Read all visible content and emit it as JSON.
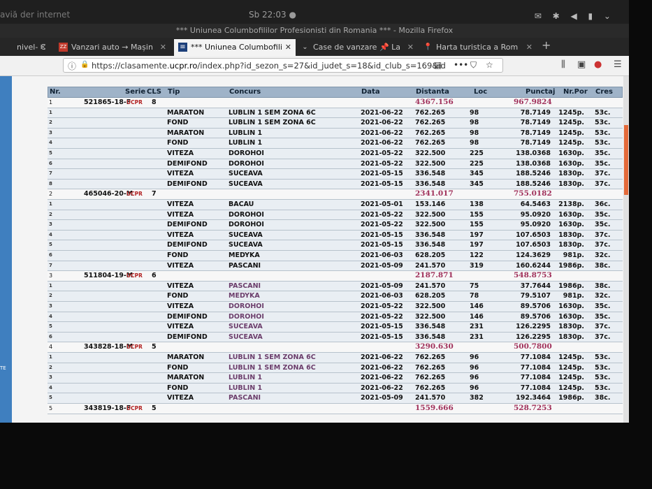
{
  "system": {
    "left_text": "aviă der internet",
    "clock": "Sb 22:03 ●",
    "icons": "✉ ✱ ◀ ▮ ⌄"
  },
  "window": {
    "title": "*** Uniunea Columbofililor Profesionisti din Romania *** - Mozilla Firefox"
  },
  "tabs": [
    {
      "label": "nivel- C",
      "icon": "",
      "active": false
    },
    {
      "label": "Vanzari auto → Mașin",
      "icon": "ZZ",
      "active": false
    },
    {
      "label": "*** Uniunea Columbofili",
      "icon": "≡",
      "active": true
    },
    {
      "label": "Case de vanzare 📌 La",
      "icon": "⌄",
      "active": false
    },
    {
      "label": "Harta turistica a Rom",
      "icon": "📍",
      "active": false
    }
  ],
  "newtab": "+",
  "url": {
    "prefix": "https://clasamente.",
    "domain": "ucpr.ro",
    "rest": "/index.php?id_sezon_s=27&id_judet_s=18&id_club_s=169&id"
  },
  "table": {
    "headers": [
      "Nr.",
      "Serie",
      "CLS",
      "Tip",
      "Concurs",
      "Data",
      "Distanta",
      "Loc",
      "Punctaj",
      "Nr.Por",
      "Cres"
    ],
    "groups": [
      {
        "nr": "1",
        "serie": "521865-18-F",
        "org": "UCPR",
        "cls": "8",
        "dist_total": "4367.156",
        "punctaj_total": "967.9824",
        "rows": [
          [
            "MARATON",
            "LUBLIN 1 SEM ZONA 6C",
            "2021-06-22",
            "762.265",
            "98",
            "78.7149",
            "1245p.",
            "53c."
          ],
          [
            "FOND",
            "LUBLIN 1 SEM ZONA 6C",
            "2021-06-22",
            "762.265",
            "98",
            "78.7149",
            "1245p.",
            "53c."
          ],
          [
            "MARATON",
            "LUBLIN 1",
            "2021-06-22",
            "762.265",
            "98",
            "78.7149",
            "1245p.",
            "53c."
          ],
          [
            "FOND",
            "LUBLIN 1",
            "2021-06-22",
            "762.265",
            "98",
            "78.7149",
            "1245p.",
            "53c."
          ],
          [
            "VITEZA",
            "DOROHOI",
            "2021-05-22",
            "322.500",
            "225",
            "138.0368",
            "1630p.",
            "35c."
          ],
          [
            "DEMIFOND",
            "DOROHOI",
            "2021-05-22",
            "322.500",
            "225",
            "138.0368",
            "1630p.",
            "35c."
          ],
          [
            "VITEZA",
            "SUCEAVA",
            "2021-05-15",
            "336.548",
            "345",
            "188.5246",
            "1830p.",
            "37c."
          ],
          [
            "DEMIFOND",
            "SUCEAVA",
            "2021-05-15",
            "336.548",
            "345",
            "188.5246",
            "1830p.",
            "37c."
          ]
        ]
      },
      {
        "nr": "2",
        "serie": "465046-20-M",
        "org": "UCPR",
        "cls": "7",
        "dist_total": "2341.017",
        "punctaj_total": "755.0182",
        "rows": [
          [
            "VITEZA",
            "BACAU",
            "2021-05-01",
            "153.146",
            "138",
            "64.5463",
            "2138p.",
            "36c."
          ],
          [
            "VITEZA",
            "DOROHOI",
            "2021-05-22",
            "322.500",
            "155",
            "95.0920",
            "1630p.",
            "35c."
          ],
          [
            "DEMIFOND",
            "DOROHOI",
            "2021-05-22",
            "322.500",
            "155",
            "95.0920",
            "1630p.",
            "35c."
          ],
          [
            "VITEZA",
            "SUCEAVA",
            "2021-05-15",
            "336.548",
            "197",
            "107.6503",
            "1830p.",
            "37c."
          ],
          [
            "DEMIFOND",
            "SUCEAVA",
            "2021-05-15",
            "336.548",
            "197",
            "107.6503",
            "1830p.",
            "37c."
          ],
          [
            "FOND",
            "MEDYKA",
            "2021-06-03",
            "628.205",
            "122",
            "124.3629",
            "981p.",
            "32c."
          ],
          [
            "VITEZA",
            "PASCANI",
            "2021-05-09",
            "241.570",
            "319",
            "160.6244",
            "1986p.",
            "38c."
          ]
        ]
      },
      {
        "nr": "3",
        "serie": "511804-19-M",
        "org": "UCPR",
        "cls": "6",
        "dist_total": "2187.871",
        "punctaj_total": "548.8753",
        "rows": [
          [
            "VITEZA",
            "PASCANI",
            "2021-05-09",
            "241.570",
            "75",
            "37.7644",
            "1986p.",
            "38c."
          ],
          [
            "FOND",
            "MEDYKA",
            "2021-06-03",
            "628.205",
            "78",
            "79.5107",
            "981p.",
            "32c."
          ],
          [
            "VITEZA",
            "DOROHOI",
            "2021-05-22",
            "322.500",
            "146",
            "89.5706",
            "1630p.",
            "35c."
          ],
          [
            "DEMIFOND",
            "DOROHOI",
            "2021-05-22",
            "322.500",
            "146",
            "89.5706",
            "1630p.",
            "35c."
          ],
          [
            "VITEZA",
            "SUCEAVA",
            "2021-05-15",
            "336.548",
            "231",
            "126.2295",
            "1830p.",
            "37c."
          ],
          [
            "DEMIFOND",
            "SUCEAVA",
            "2021-05-15",
            "336.548",
            "231",
            "126.2295",
            "1830p.",
            "37c."
          ]
        ]
      },
      {
        "nr": "4",
        "serie": "343828-18-M",
        "org": "UCPR",
        "cls": "5",
        "dist_total": "3290.630",
        "punctaj_total": "500.7800",
        "rows": [
          [
            "MARATON",
            "LUBLIN 1 SEM ZONA 6C",
            "2021-06-22",
            "762.265",
            "96",
            "77.1084",
            "1245p.",
            "53c."
          ],
          [
            "FOND",
            "LUBLIN 1 SEM ZONA 6C",
            "2021-06-22",
            "762.265",
            "96",
            "77.1084",
            "1245p.",
            "53c."
          ],
          [
            "MARATON",
            "LUBLIN 1",
            "2021-06-22",
            "762.265",
            "96",
            "77.1084",
            "1245p.",
            "53c."
          ],
          [
            "FOND",
            "LUBLIN 1",
            "2021-06-22",
            "762.265",
            "96",
            "77.1084",
            "1245p.",
            "53c."
          ],
          [
            "VITEZA",
            "PASCANI",
            "2021-05-09",
            "241.570",
            "382",
            "192.3464",
            "1986p.",
            "38c."
          ]
        ]
      },
      {
        "nr": "5",
        "serie": "343819-18-F",
        "org": "UCPR",
        "cls": "5",
        "dist_total": "1559.666",
        "punctaj_total": "528.7253",
        "rows": []
      }
    ]
  },
  "left_strip_text": "TE"
}
